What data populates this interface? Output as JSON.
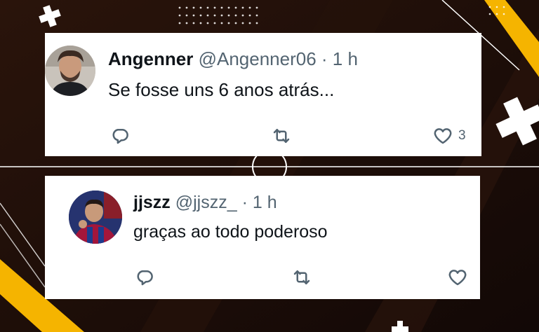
{
  "tweets": [
    {
      "name": "Angenner",
      "handle": "@Angenner06",
      "separator": "·",
      "time": "1 h",
      "text": "Se fosse uns 6 anos atrás...",
      "like_count": "3",
      "avatar_icon": "person-avatar-icon"
    },
    {
      "name": "jjszz",
      "handle": "@jjszz_",
      "separator": "·",
      "time": "1 h",
      "text": "graças ao todo poderoso",
      "like_count": "",
      "avatar_icon": "person-avatar-icon"
    }
  ],
  "colors": {
    "background": "#1a0d08",
    "accent_yellow": "#f5b400",
    "card": "#ffffff",
    "name_text": "#0f1419",
    "meta_text": "#536471"
  },
  "icons": [
    "reply-icon",
    "retweet-icon",
    "like-icon"
  ]
}
